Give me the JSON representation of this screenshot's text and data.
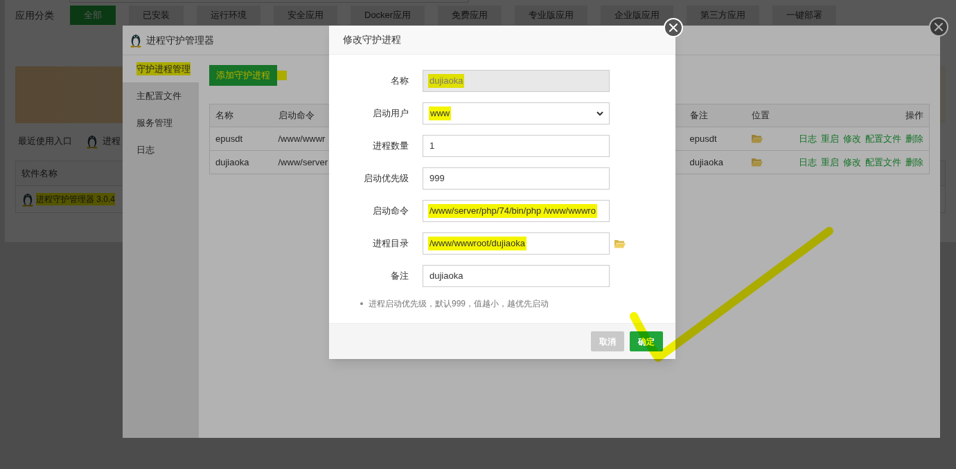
{
  "background": {
    "category_label": "应用分类",
    "categories": [
      {
        "label": "全部",
        "selected": true
      },
      {
        "label": "已安装",
        "selected": false
      },
      {
        "label": "运行环境",
        "selected": false
      },
      {
        "label": "安全应用",
        "selected": false
      },
      {
        "label": "Docker应用",
        "selected": false
      },
      {
        "label": "免费应用",
        "selected": false
      },
      {
        "label": "专业版应用",
        "selected": false
      },
      {
        "label": "企业版应用",
        "selected": false
      },
      {
        "label": "第三方应用",
        "selected": false
      },
      {
        "label": "一键部署",
        "selected": false
      }
    ],
    "recent_label": "最近使用入口",
    "recent_items": [
      {
        "label": "进程"
      }
    ],
    "software_table": {
      "columns": [
        "软件名称"
      ],
      "rows": [
        {
          "name": "进程守护管理器 3.0.4",
          "highlighted": true
        }
      ]
    }
  },
  "manager_window": {
    "title": "进程守护管理器",
    "sidebar": [
      {
        "label": "守护进程管理",
        "selected": true,
        "highlighted": true
      },
      {
        "label": "主配置文件",
        "selected": false,
        "highlighted": false
      },
      {
        "label": "服务管理",
        "selected": false,
        "highlighted": false
      },
      {
        "label": "日志",
        "selected": false,
        "highlighted": false
      }
    ],
    "add_button": {
      "label": "添加守护进程",
      "highlighted": true
    },
    "table": {
      "columns": [
        "名称",
        "启动命令",
        "备注",
        "位置",
        "操作"
      ],
      "rows": [
        {
          "name": "epusdt",
          "command": "/www/wwwr",
          "note": "epusdt",
          "actions": [
            "日志",
            "重启",
            "修改",
            "配置文件",
            "删除"
          ]
        },
        {
          "name": "dujiaoka",
          "command": "/www/server",
          "note": "dujiaoka",
          "actions": [
            "日志",
            "重启",
            "修改",
            "配置文件",
            "删除"
          ]
        }
      ]
    }
  },
  "dialog": {
    "title": "修改守护进程",
    "fields": [
      {
        "kind": "text",
        "label": "名称",
        "value": "dujiaoka",
        "disabled": true,
        "highlighted": true
      },
      {
        "kind": "select",
        "label": "启动用户",
        "value": "www",
        "disabled": false,
        "highlighted": true
      },
      {
        "kind": "text",
        "label": "进程数量",
        "value": "1",
        "disabled": false,
        "highlighted": false
      },
      {
        "kind": "text",
        "label": "启动优先级",
        "value": "999",
        "disabled": false,
        "highlighted": false
      },
      {
        "kind": "text",
        "label": "启动命令",
        "value": "/www/server/php/74/bin/php /www/wwwro",
        "disabled": false,
        "highlighted": true
      },
      {
        "kind": "path",
        "label": "进程目录",
        "value": "/www/wwwroot/dujiaoka",
        "disabled": false,
        "highlighted": true
      },
      {
        "kind": "text",
        "label": "备注",
        "value": "dujiaoka",
        "disabled": false,
        "highlighted": false
      }
    ],
    "note": "进程启动优先级，默认999，值越小，越优先启动",
    "buttons": [
      {
        "kind": "cancel",
        "label": "取消"
      },
      {
        "kind": "confirm",
        "label": "确定"
      }
    ]
  }
}
